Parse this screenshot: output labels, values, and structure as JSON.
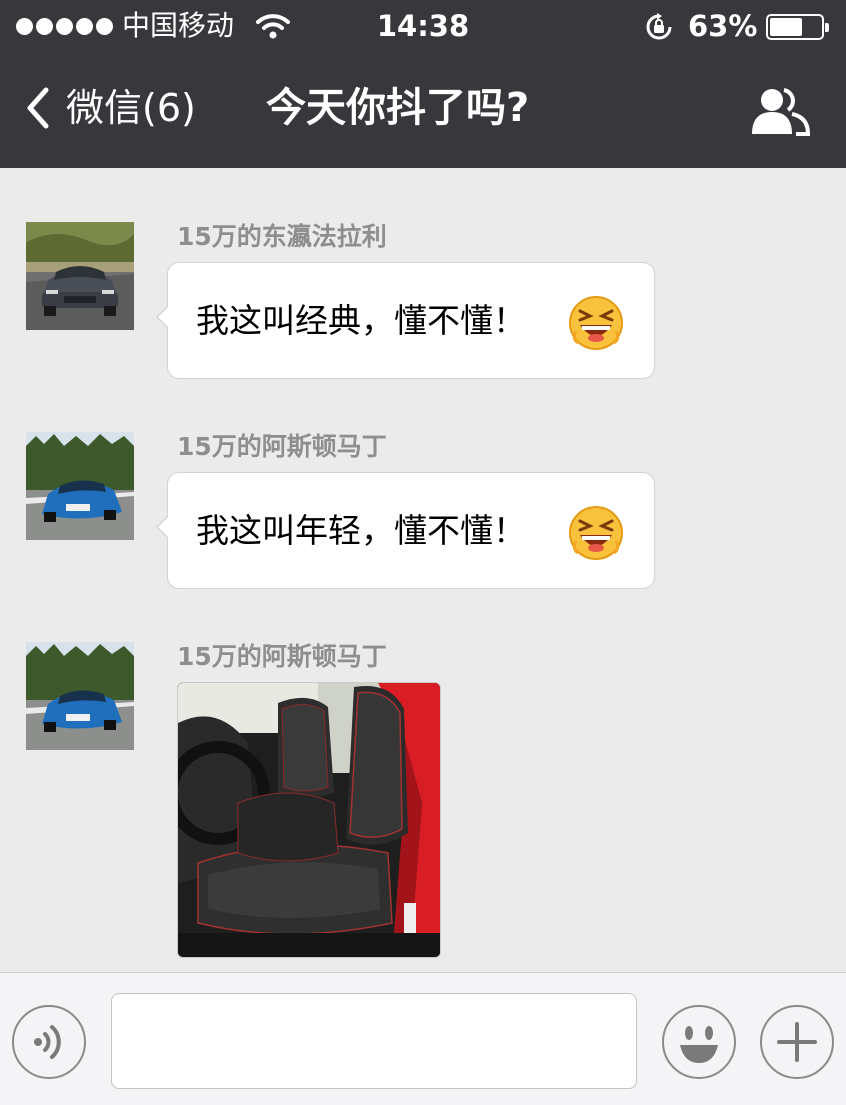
{
  "status_bar": {
    "carrier": "中国移动",
    "time": "14:38",
    "battery_percent_label": "63%",
    "battery_level": 0.63,
    "signal_bars": 5,
    "icons": [
      "wifi-icon",
      "rotation-lock-icon",
      "battery-icon"
    ]
  },
  "nav": {
    "back_label": "微信(6)",
    "title": "今天你抖了吗?",
    "icons": [
      "chevron-left-icon",
      "contacts-icon"
    ]
  },
  "messages": [
    {
      "sender": "15万的东瀛法拉利",
      "text": "我这叫经典，懂不懂！",
      "emoji": "grinning-squint-emoji",
      "avatar": "silver-sedan-photo"
    },
    {
      "sender": "15万的阿斯顿马丁",
      "text": "我这叫年轻，懂不懂！",
      "emoji": "grinning-squint-emoji",
      "avatar": "blue-hatchback-photo"
    },
    {
      "sender": "15万的阿斯顿马丁",
      "image": "car-front-seats-photo",
      "avatar": "blue-hatchback-photo"
    }
  ],
  "input_bar": {
    "text_value": "",
    "icons": [
      "voice-icon",
      "emoji-face-icon",
      "plus-icon"
    ]
  },
  "colors": {
    "header_bg": "#38383c",
    "chat_bg": "#ebebeb",
    "bubble_bg": "#ffffff",
    "sender_text": "#8e8e8e",
    "input_bar_bg": "#f4f4f6"
  }
}
